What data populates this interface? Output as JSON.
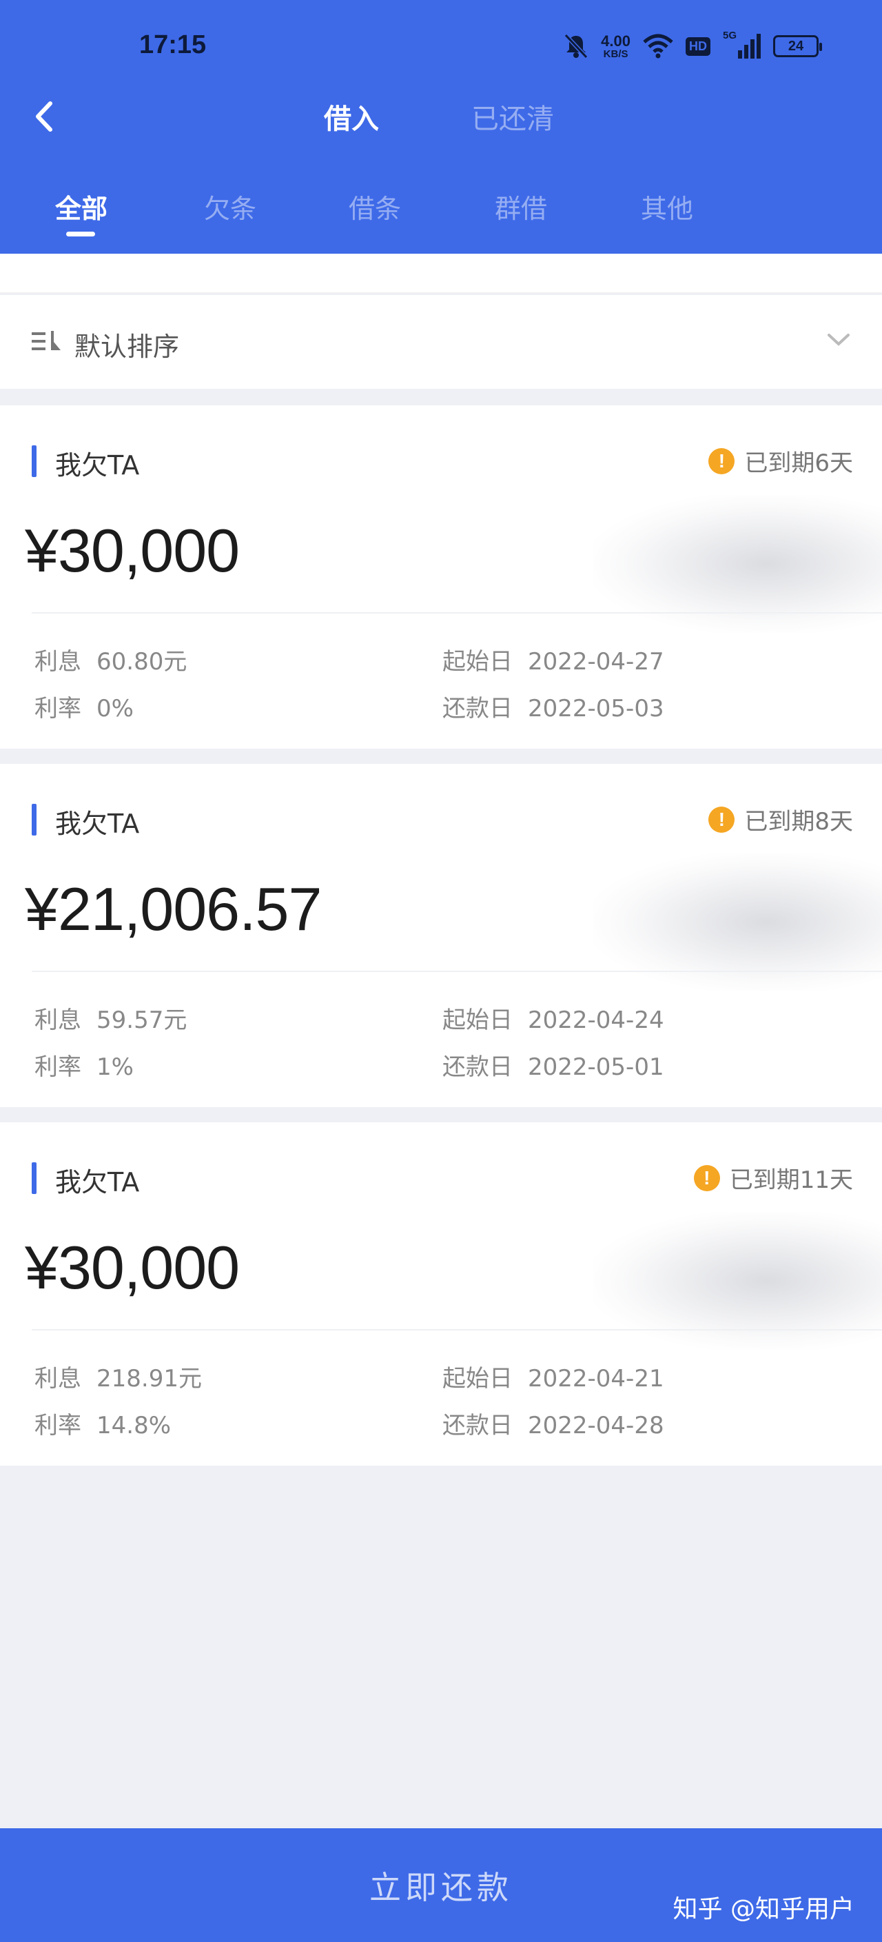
{
  "status_bar": {
    "time": "17:15",
    "speed_value": "4.00",
    "speed_unit": "KB/S",
    "hd": "HD",
    "network": "5G",
    "battery": "24"
  },
  "header": {
    "tabs": [
      {
        "label": "借入",
        "active": true
      },
      {
        "label": "已还清",
        "active": false
      }
    ],
    "sub_tabs": [
      {
        "label": "全部",
        "active": true
      },
      {
        "label": "欠条",
        "active": false
      },
      {
        "label": "借条",
        "active": false
      },
      {
        "label": "群借",
        "active": false
      },
      {
        "label": "其他",
        "active": false
      }
    ]
  },
  "sort": {
    "label": "默认排序"
  },
  "cards": [
    {
      "type": "我欠TA",
      "status": "已到期6天",
      "amount": "¥30,000",
      "interest_label": "利息",
      "interest_value": "60.80元",
      "rate_label": "利率",
      "rate_value": "0%",
      "start_label": "起始日",
      "start_value": "2022-04-27",
      "due_label": "还款日",
      "due_value": "2022-05-03"
    },
    {
      "type": "我欠TA",
      "status": "已到期8天",
      "amount": "¥21,006.57",
      "interest_label": "利息",
      "interest_value": "59.57元",
      "rate_label": "利率",
      "rate_value": "1%",
      "start_label": "起始日",
      "start_value": "2022-04-24",
      "due_label": "还款日",
      "due_value": "2022-05-01"
    },
    {
      "type": "我欠TA",
      "status": "已到期11天",
      "amount": "¥30,000",
      "interest_label": "利息",
      "interest_value": "218.91元",
      "rate_label": "利率",
      "rate_value": "14.8%",
      "start_label": "起始日",
      "start_value": "2022-04-21",
      "due_label": "还款日",
      "due_value": "2022-04-28"
    }
  ],
  "bottom_button": {
    "label": "立即还款"
  },
  "watermark": "知乎 @知乎用户",
  "colors": {
    "primary": "#3e6ae8",
    "warning": "#f5a623",
    "background": "#eef0f5"
  }
}
